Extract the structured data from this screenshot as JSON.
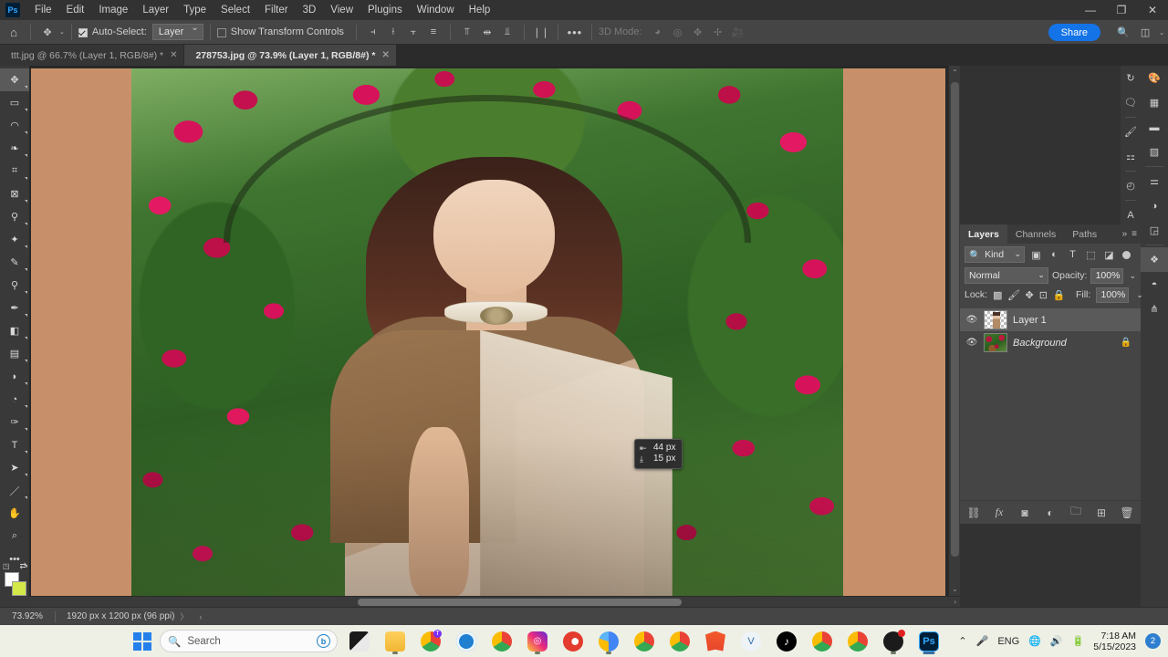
{
  "app": {
    "name": "Adobe Photoshop",
    "logo_text": "Ps"
  },
  "menubar": {
    "items": [
      {
        "label": "File"
      },
      {
        "label": "Edit"
      },
      {
        "label": "Image"
      },
      {
        "label": "Layer"
      },
      {
        "label": "Type"
      },
      {
        "label": "Select"
      },
      {
        "label": "Filter"
      },
      {
        "label": "3D"
      },
      {
        "label": "View"
      },
      {
        "label": "Plugins"
      },
      {
        "label": "Window"
      },
      {
        "label": "Help"
      }
    ],
    "window_controls": {
      "minimize": "—",
      "restore": "❐",
      "close": "✕"
    }
  },
  "options_bar": {
    "home_icon": "home-icon",
    "tool_icon": "move-tool-icon",
    "auto_select_label": "Auto-Select:",
    "auto_select_checked": true,
    "auto_select_value": "Layer",
    "show_transform_label": "Show Transform Controls",
    "show_transform_checked": false,
    "align_left_icon": "align-left-edges-icon",
    "align_hcenter_icon": "align-horizontal-centers-icon",
    "align_right_icon": "align-right-edges-icon",
    "align_distribute_icon": "align-bottom-edges-icon",
    "align_top_icon": "align-top-edges-icon",
    "align_vcenter_icon": "align-vertical-centers-icon",
    "align_bottom_icon": "distribute-vertical-icon",
    "distribute_icon": "distribute-horizontal-icon",
    "more_label": "•••",
    "mode_3d_label": "3D Mode:",
    "mode_3d_icons": [
      "orbit-3d-icon",
      "roll-3d-icon",
      "pan-3d-icon",
      "slide-3d-icon",
      "camera-3d-icon"
    ],
    "share_label": "Share",
    "search_icon": "search-icon",
    "workspace_icon": "workspace-switcher-icon",
    "workspace_caret": "⌄"
  },
  "tabs": [
    {
      "title": "ttt.jpg @ 66.7% (Layer 1, RGB/8#) *",
      "close": "✕",
      "active": false
    },
    {
      "title": "278753.jpg @ 73.9% (Layer 1, RGB/8#) *",
      "close": "✕",
      "active": true
    }
  ],
  "toolbar": {
    "tools": [
      {
        "name": "move-tool",
        "glyph": "✥",
        "active": true
      },
      {
        "name": "rectangular-marquee-tool",
        "glyph": "▭"
      },
      {
        "name": "lasso-tool",
        "glyph": "◯"
      },
      {
        "name": "object-selection-tool",
        "glyph": "✧"
      },
      {
        "name": "crop-tool",
        "glyph": "⌗"
      },
      {
        "name": "frame-tool",
        "glyph": "⊠"
      },
      {
        "name": "eyedropper-tool",
        "glyph": "⚲"
      },
      {
        "name": "spot-healing-brush-tool",
        "glyph": "⟡"
      },
      {
        "name": "brush-tool",
        "glyph": "✎"
      },
      {
        "name": "clone-stamp-tool",
        "glyph": "♟"
      },
      {
        "name": "history-brush-tool",
        "glyph": "✒"
      },
      {
        "name": "eraser-tool",
        "glyph": "◨"
      },
      {
        "name": "gradient-tool",
        "glyph": "▤"
      },
      {
        "name": "blur-tool",
        "glyph": "💧"
      },
      {
        "name": "dodge-tool",
        "glyph": "◔"
      },
      {
        "name": "pen-tool",
        "glyph": "✐"
      },
      {
        "name": "horizontal-type-tool",
        "glyph": "T"
      },
      {
        "name": "path-selection-tool",
        "glyph": "➤"
      },
      {
        "name": "line-tool",
        "glyph": "／"
      },
      {
        "name": "hand-tool",
        "glyph": "✋"
      },
      {
        "name": "zoom-tool",
        "glyph": "⌕"
      },
      {
        "name": "edit-toolbar",
        "glyph": "•••"
      }
    ],
    "foreground_color": "#ffffff",
    "background_color": "#d4e84a",
    "quick_mask_icon": "quick-mask-icon",
    "screen_mode_icon": "screen-mode-icon"
  },
  "canvas": {
    "matte_color": "#c8906a",
    "hud": {
      "horizontal_label": "44 px",
      "vertical_label": "15 px",
      "horizontal_glyph": "⇤",
      "vertical_glyph": "⤓"
    }
  },
  "status_bar": {
    "zoom": "73.92%",
    "doc_size": "1920 px x 1200 px (96 ppi)",
    "next_arrow": "〉",
    "prev_arrow": "‹"
  },
  "panels": {
    "tabs": [
      {
        "label": "Layers",
        "active": true
      },
      {
        "label": "Channels",
        "active": false
      },
      {
        "label": "Paths",
        "active": false
      }
    ],
    "collapse_icon": "»",
    "menu_icon": "≡",
    "filter": {
      "search_icon": "search-icon",
      "kind_label": "Kind",
      "caret": "⌄",
      "icons": [
        "filter-pixel-icon",
        "filter-adjustment-icon",
        "filter-type-icon",
        "filter-shape-icon",
        "filter-smart-object-icon"
      ],
      "toggle_name": "filter-toggle"
    },
    "blend_mode": "Normal",
    "opacity_label": "Opacity:",
    "opacity_value": "100%",
    "fill_label": "Fill:",
    "fill_value": "100%",
    "lock_label": "Lock:",
    "lock_icons": [
      "lock-transparent-pixels-icon",
      "lock-image-pixels-icon",
      "lock-position-icon",
      "lock-artboard-icon",
      "lock-all-icon"
    ],
    "layers": [
      {
        "name": "Layer 1",
        "visible": true,
        "selected": true,
        "locked": false,
        "italic": false,
        "eye": "👁"
      },
      {
        "name": "Background",
        "visible": true,
        "selected": false,
        "locked": true,
        "italic": true,
        "eye": "👁",
        "lock_glyph": "🔒"
      }
    ],
    "footer_icons": [
      {
        "name": "link-layers-icon",
        "glyph": "⛓"
      },
      {
        "name": "layer-style-icon",
        "glyph": "fx"
      },
      {
        "name": "layer-mask-icon",
        "glyph": "◙"
      },
      {
        "name": "adjustment-layer-icon",
        "glyph": "◐"
      },
      {
        "name": "new-group-icon",
        "glyph": "🗀"
      },
      {
        "name": "new-layer-icon",
        "glyph": "⊞"
      },
      {
        "name": "delete-layer-icon",
        "glyph": "🗑"
      }
    ]
  },
  "right_rail": {
    "icons": [
      {
        "name": "color-panel-icon",
        "glyph": "🎨"
      },
      {
        "name": "swatches-panel-icon",
        "glyph": "▦"
      },
      {
        "name": "gradients-panel-icon",
        "glyph": "▬"
      },
      {
        "name": "patterns-panel-icon",
        "glyph": "▨"
      },
      {
        "name": "adjustments-panel-icon",
        "glyph": "⚌"
      },
      {
        "name": "properties-panel-icon",
        "glyph": "◑"
      },
      {
        "name": "libraries-panel-icon",
        "glyph": "◲"
      },
      {
        "name": "layers-panel-icon",
        "glyph": "❖",
        "active": true
      },
      {
        "name": "channels-panel-icon",
        "glyph": "◓"
      },
      {
        "name": "paths-panel-icon",
        "glyph": "⋔"
      }
    ],
    "secondary_icons": [
      {
        "name": "history-panel-icon",
        "glyph": "↻"
      },
      {
        "name": "comments-panel-icon",
        "glyph": "💬"
      },
      {
        "name": "brush-settings-icon",
        "glyph": "🖌"
      },
      {
        "name": "brushes-panel-icon",
        "glyph": "⚏"
      },
      {
        "name": "history-states-icon",
        "glyph": "◴"
      },
      {
        "name": "character-panel-icon",
        "glyph": "A"
      }
    ]
  },
  "taskbar": {
    "start_name": "windows-start-button",
    "search_placeholder": "Search",
    "search_icon": "search-icon",
    "bing_icon": "bing-chat-icon",
    "apps": [
      {
        "name": "file-explorer-dark-icon",
        "glyph": ""
      },
      {
        "name": "file-explorer-icon",
        "glyph": ""
      },
      {
        "name": "chrome-profile-t-icon",
        "glyph": ""
      },
      {
        "name": "microsoft-store-icon",
        "glyph": ""
      },
      {
        "name": "chrome-beta-icon",
        "glyph": ""
      },
      {
        "name": "instagram-icon",
        "glyph": ""
      },
      {
        "name": "opera-icon",
        "glyph": ""
      },
      {
        "name": "chrome-canary-icon",
        "glyph": ""
      },
      {
        "name": "chrome-dev-beta-icon",
        "glyph": ""
      },
      {
        "name": "chrome-beta-n-icon",
        "glyph": ""
      },
      {
        "name": "brave-browser-icon",
        "glyph": ""
      },
      {
        "name": "vivaldi-icon",
        "glyph": ""
      },
      {
        "name": "tiktok-icon",
        "glyph": ""
      },
      {
        "name": "chrome-icon-1",
        "glyph": ""
      },
      {
        "name": "chrome-icon-2",
        "glyph": ""
      },
      {
        "name": "adobe-bridge-icon",
        "glyph": ""
      },
      {
        "name": "photoshop-taskbar-icon",
        "glyph": "Ps"
      }
    ],
    "tray": {
      "chevron": "⌃",
      "mic_icon": "microphone-icon",
      "language": "ENG",
      "network_icon": "network-icon",
      "volume_icon": "volume-icon",
      "battery_icon": "battery-icon",
      "time": "7:18 AM",
      "date": "5/15/2023",
      "notification_count": "2"
    }
  }
}
